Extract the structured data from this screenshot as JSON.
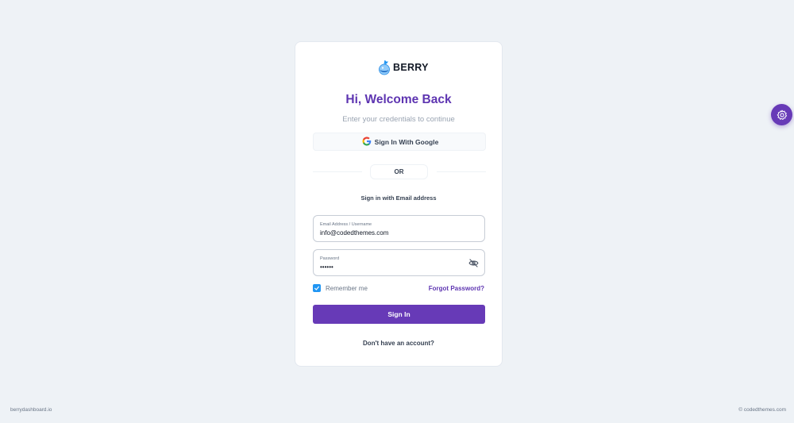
{
  "brand": {
    "name": "BERRY",
    "color": "#5e35b1",
    "accent": "#673ab7"
  },
  "login": {
    "title": "Hi, Welcome Back",
    "subtitle": "Enter your credentials to continue",
    "google_label": "Sign In With Google",
    "divider": "OR",
    "email_heading": "Sign in with Email address",
    "email": {
      "label": "Email Address / Username",
      "value": "info@codedthemes.com"
    },
    "password": {
      "label": "Password",
      "value": "••••••"
    },
    "remember_label": "Remember me",
    "remember_checked": true,
    "forgot_label": "Forgot Password?",
    "submit_label": "Sign In",
    "no_account_label": "Don't have an account?"
  },
  "footer": {
    "left": "berrydashboard.io",
    "right": "© codedthemes.com"
  },
  "icons": {
    "logo": "berry-logo-icon",
    "google": "google-icon",
    "password_toggle": "eye-off-icon",
    "settings": "gear-icon",
    "check": "check-icon"
  }
}
